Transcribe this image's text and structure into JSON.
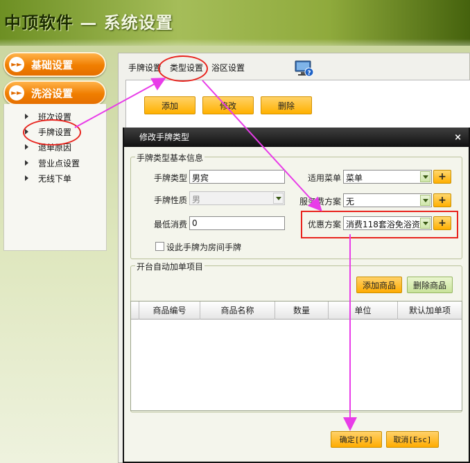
{
  "header": {
    "brand": "中顶软件",
    "title": " — 系统设置"
  },
  "nav": {
    "buttons": [
      {
        "label": "基础设置"
      },
      {
        "label": "洗浴设置"
      }
    ],
    "subitems": [
      {
        "label": "班次设置"
      },
      {
        "label": "手牌设置"
      },
      {
        "label": "退单原因"
      },
      {
        "label": "营业点设置"
      },
      {
        "label": "无线下单"
      }
    ]
  },
  "tabs": [
    {
      "label": "手牌设置"
    },
    {
      "label": "类型设置"
    },
    {
      "label": "浴区设置"
    }
  ],
  "toolbar": {
    "add": "添加",
    "edit": "修改",
    "delete": "删除"
  },
  "dialog": {
    "title": "修改手牌类型",
    "close": "×",
    "basic_group": "手牌类型基本信息",
    "fields": {
      "card_type_label": "手牌类型",
      "card_type_value": "男宾",
      "card_nature_label": "手牌性质",
      "card_nature_value": "男",
      "min_spend_label": "最低消费",
      "min_spend_value": "0",
      "menu_label": "适用菜单",
      "menu_value": "菜单",
      "service_label": "服务费方案",
      "service_value": "无",
      "discount_label": "优惠方案",
      "discount_value": "消费118套浴免浴资",
      "room_card_label": "设此手牌为房间手牌"
    },
    "plus": "+",
    "auto_group": "开台自动加单项目",
    "add_goods": "添加商品",
    "delete_goods": "删除商品",
    "columns": [
      "商品编号",
      "商品名称",
      "数量",
      "单位",
      "默认加单项"
    ],
    "ok": "确定[F9]",
    "cancel": "取消[Esc]"
  },
  "colors": {
    "accent_orange": "#f07e00",
    "annotation_red": "#e8231d",
    "arrow_magenta": "#e83ce8"
  }
}
